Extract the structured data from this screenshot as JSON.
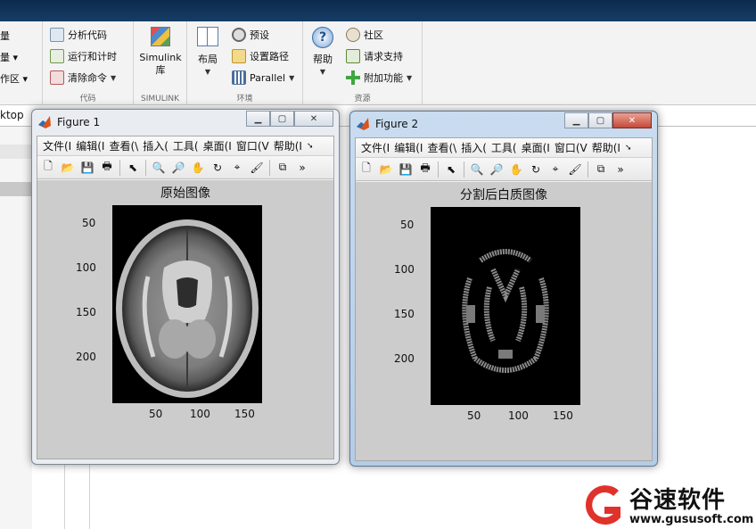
{
  "ribbon": {
    "sec1": {
      "items": [
        "量",
        "量 ▾",
        "作区 ▾"
      ]
    },
    "code": {
      "analyze": "分析代码",
      "run_time": "运行和计时",
      "clear": "清除命令",
      "caption": "代码"
    },
    "simulink": {
      "label1": "Simulink",
      "label2": "库",
      "caption": "SIMULINK"
    },
    "env": {
      "layout": "布局",
      "prefs": "预设",
      "setpath": "设置路径",
      "parallel": "Parallel",
      "caption": "环境"
    },
    "res": {
      "help": "帮助",
      "community": "社区",
      "support": "请求支持",
      "addons": "附加功能",
      "caption": "资源"
    }
  },
  "address": {
    "text": "ktop"
  },
  "figure1": {
    "title": "Figure 1",
    "menu": [
      "文件(I",
      "编辑(I",
      "查看(\\",
      "插入(",
      "工具(",
      "桌面(I",
      "窗口(V",
      "帮助(I"
    ],
    "plot_title": "原始图像",
    "yticks": [
      "50",
      "100",
      "150",
      "200"
    ],
    "xticks": [
      "50",
      "100",
      "150"
    ]
  },
  "figure2": {
    "title": "Figure 2",
    "menu": [
      "文件(I",
      "编辑(I",
      "查看(\\",
      "插入(",
      "工具(",
      "桌面(I",
      "窗口(V",
      "帮助(I"
    ],
    "plot_title": "分割后白质图像",
    "yticks": [
      "50",
      "100",
      "150",
      "200"
    ],
    "xticks": [
      "50",
      "100",
      "150"
    ]
  },
  "watermark": {
    "name": "谷速软件",
    "url": "www.gususoft.com"
  },
  "colors": {
    "accent_red": "#e0322b",
    "title_bar": "#0c2a4d"
  }
}
